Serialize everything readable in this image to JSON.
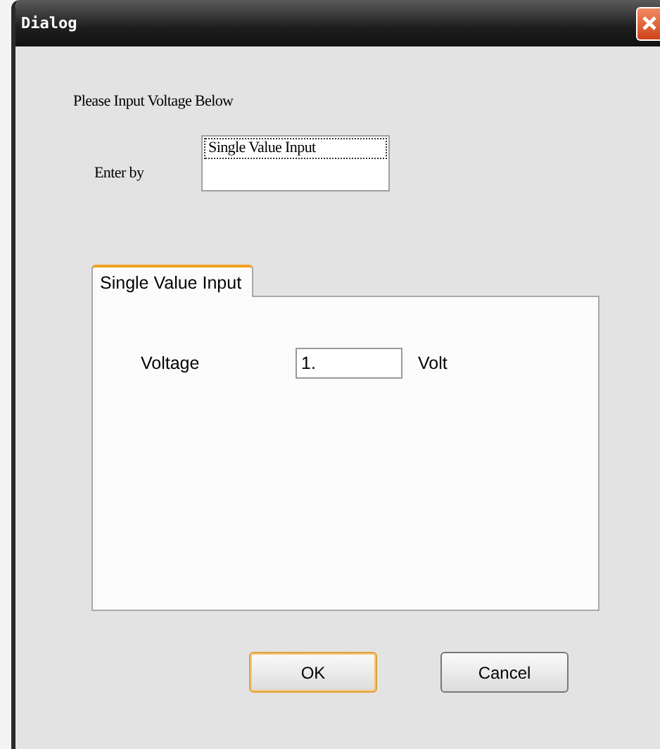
{
  "window": {
    "title": "Dialog"
  },
  "prompt": "Please Input Voltage Below",
  "enter_by": {
    "label": "Enter by",
    "items": [
      {
        "label": "Single Value Input",
        "selected": true
      }
    ]
  },
  "tabs": [
    {
      "label": "Single Value Input",
      "selected": true
    }
  ],
  "voltage": {
    "label": "Voltage",
    "value": "1.",
    "unit": "Volt"
  },
  "buttons": [
    {
      "label": "OK",
      "default": true
    },
    {
      "label": "Cancel",
      "default": false
    }
  ]
}
